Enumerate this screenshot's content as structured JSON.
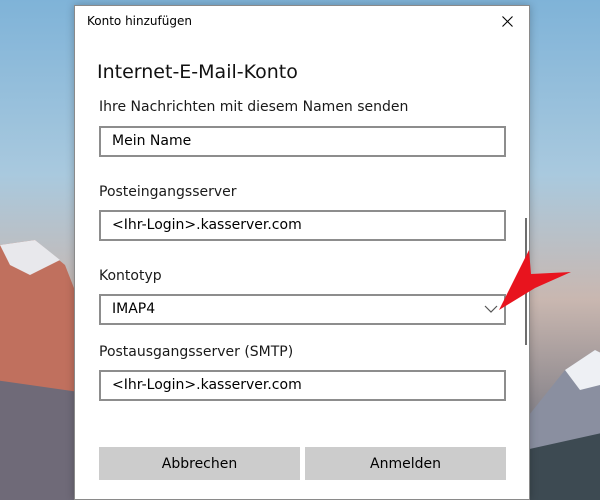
{
  "window": {
    "title": "Konto hinzufügen",
    "close_icon": "close-icon"
  },
  "heading": "Internet-E-Mail-Konto",
  "fields": {
    "name": {
      "label": "Ihre Nachrichten mit diesem Namen senden",
      "value": "Mein Name"
    },
    "incoming": {
      "label": "Posteingangsserver",
      "value": "<Ihr-Login>.kasserver.com"
    },
    "account_type": {
      "label": "Kontotyp",
      "value": "IMAP4",
      "icon": "chevron-down-icon"
    },
    "outgoing": {
      "label": "Postausgangsserver (SMTP)",
      "value": "<Ihr-Login>.kasserver.com"
    }
  },
  "buttons": {
    "cancel": "Abbrechen",
    "sign_in": "Anmelden"
  },
  "annotation": {
    "icon": "red-arrow-icon",
    "color": "#e8141e"
  },
  "colors": {
    "input_border": "#8d8d8d",
    "button_bg": "#cccccc",
    "dialog_bg": "#ffffff"
  }
}
